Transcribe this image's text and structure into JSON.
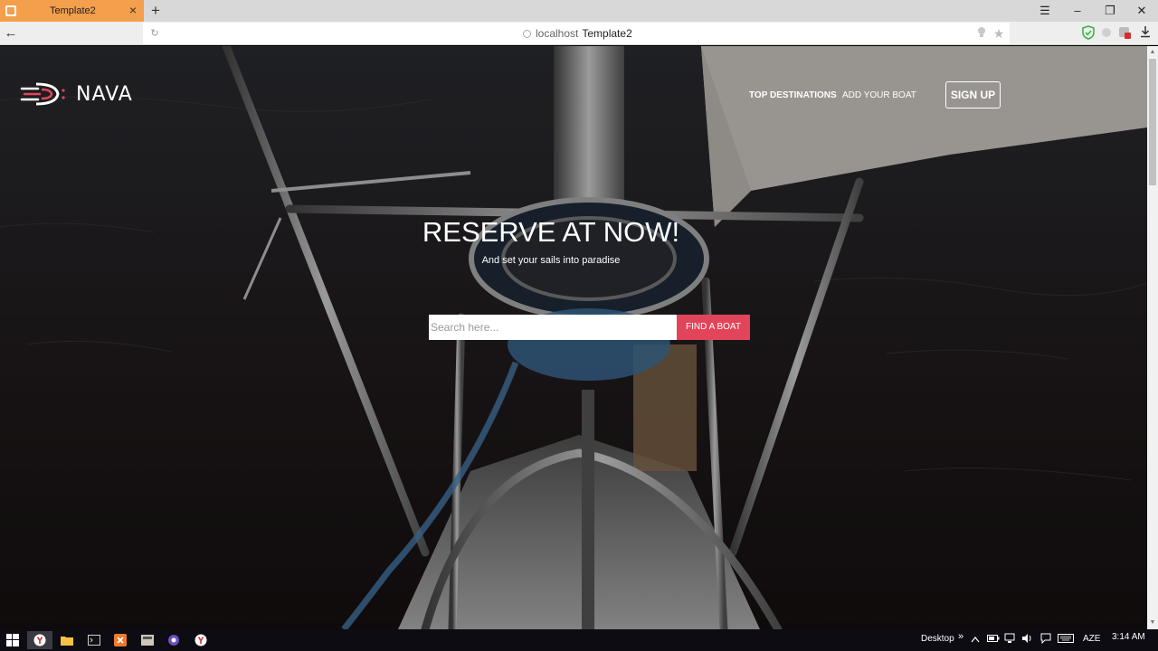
{
  "browser": {
    "tab_title": "Template2",
    "tab_close": "×",
    "new_tab": "+",
    "window_controls": {
      "menu": "☰",
      "minimize": "–",
      "maximize": "❐",
      "close": "✕"
    },
    "back": "←",
    "reload": "↻",
    "url_host": "localhost",
    "url_page": "Template2",
    "bookmark_star": "★",
    "extensions": [
      "shield-check-icon",
      "sync-icon",
      "adblock-icon",
      "download-icon"
    ]
  },
  "site": {
    "logo_text": "NAVA",
    "nav": {
      "top_destinations": "TOP DESTINATIONS",
      "add_your_boat": "ADD YOUR BOAT",
      "sign_up": "SIGN UP"
    },
    "hero": {
      "title": "RESERVE AT NOW!",
      "subtitle": "And set your sails into paradise"
    },
    "search": {
      "placeholder": "Search here...",
      "value": "",
      "button": "FIND A BOAT"
    },
    "colors": {
      "accent": "#e24559",
      "tab": "#f39f4c"
    }
  },
  "taskbar": {
    "apps": [
      "start-icon",
      "yandex-browser-icon",
      "file-explorer-icon",
      "terminal-icon",
      "xampp-icon",
      "app-icon",
      "media-icon",
      "yandex-browser-icon"
    ],
    "desktop_label": "Desktop",
    "desktop_chevron": "»",
    "language": "AZE",
    "time": "3:14 AM"
  }
}
